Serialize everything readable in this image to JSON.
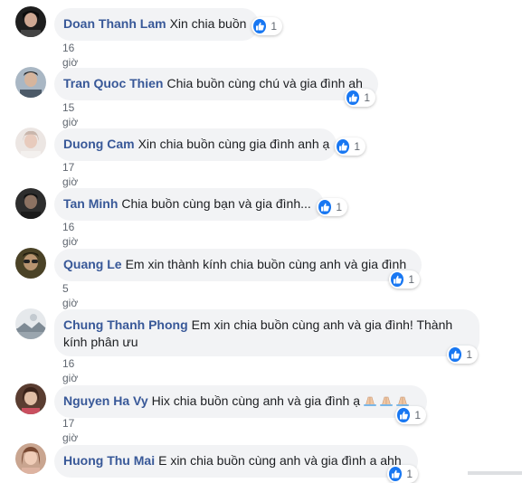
{
  "comments": [
    {
      "author": "Doan Thanh Lam",
      "text": "Xin chia buồn",
      "time": "16 giờ",
      "likes": "1",
      "avatar_color": "#2b2b2b"
    },
    {
      "author": "Tran Quoc Thien",
      "text": "Chia buồn cùng chú và gia đình ah",
      "time": "15 giờ",
      "likes": "1",
      "avatar_color": "#7c8a99"
    },
    {
      "author": "Duong Cam",
      "text": "Xin chia buồn cùng gia đình anh ạ",
      "time": "17 giờ",
      "likes": "1",
      "avatar_color": "#d9d0cc"
    },
    {
      "author": "Tan Minh",
      "text": "Chia buồn cùng bạn và gia đình...",
      "time": "16 giờ",
      "likes": "1",
      "avatar_color": "#3a3a3a"
    },
    {
      "author": "Quang Le",
      "text": "Em xin thành kính chia buồn cùng anh và gia đình",
      "time": "5 giờ",
      "likes": "1",
      "avatar_color": "#3b3520"
    },
    {
      "author": "Chung Thanh Phong",
      "text": "Em xin chia buồn cùng anh và gia đình! Thành kính phân ưu",
      "time": "16 giờ",
      "likes": "1",
      "avatar_color": "#c9ccd0"
    },
    {
      "author": "Nguyen Ha Vy",
      "text": "Hix chia buồn cùng anh và gia đình ạ",
      "time": "17 giờ",
      "likes": "1",
      "avatar_color": "#6b4a3c"
    },
    {
      "author": "Huong Thu Mai",
      "text": "E xin chia buồn cùng anh và gia đình a ahh",
      "time": "",
      "likes": "1",
      "avatar_color": "#b48c78"
    }
  ],
  "colors": {
    "author": "#385898",
    "bubble": "#f2f3f5",
    "like": "#1877f2"
  },
  "icons": {
    "like": "thumbs-up-icon",
    "pray": "folded-hands-emoji"
  }
}
